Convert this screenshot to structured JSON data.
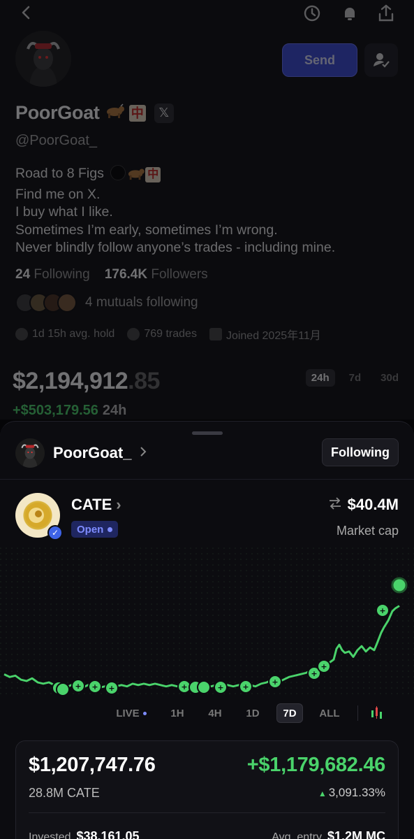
{
  "profile": {
    "display_name": "PoorGoat",
    "name_emoji": "中",
    "x_badge": "𝕏",
    "handle": "@PoorGoat_",
    "send_label": "Send",
    "bio_lines": [
      "Road to 8 Figs",
      "Find me on X.",
      "I buy what I like.",
      "Sometimes I’m early, sometimes I’m wrong.",
      "Never blindly follow anyone’s trades - including mine."
    ],
    "bio_emoji": "中",
    "following_count": "24",
    "following_label": "Following",
    "followers_count": "176.4K",
    "followers_label": "Followers",
    "mutuals_text": "4 mutuals following",
    "avg_hold": "1d 15h avg. hold",
    "trades": "769 trades",
    "joined": "Joined 2025年11月",
    "balance_main": "$2,194,912",
    "balance_cents": ".85",
    "change": "+$503,179.56",
    "change_period": "24h",
    "ranges": [
      "24h",
      "7d",
      "30d"
    ],
    "active_range": "24h"
  },
  "sheet": {
    "trader_name": "PoorGoat_",
    "following_button": "Following",
    "token_name": "CATE",
    "status": "Open",
    "market_cap": "$40.4M",
    "market_cap_label": "Market cap",
    "timeframes": [
      "LIVE",
      "1H",
      "4H",
      "1D",
      "7D",
      "ALL"
    ],
    "active_timeframe": "7D",
    "value": "$1,207,747.76",
    "pnl": "+$1,179,682.46",
    "quantity": "28.8M CATE",
    "pnl_pct": "3,091.33%",
    "invested_label": "Invested",
    "invested": "$38,161.05",
    "avg_entry_label": "Avg. entry",
    "avg_entry": "$1.2M MC"
  },
  "colors": {
    "accent_blue": "#3b4bd8",
    "positive_green": "#4ad36b",
    "open_pill": "#7e8cff"
  },
  "icons": [
    "back-icon",
    "history-icon",
    "bell-plus-icon",
    "share-icon",
    "user-check-icon",
    "verified-icon",
    "swap-icon",
    "candlestick-icon",
    "clock-icon",
    "trades-icon",
    "calendar-icon"
  ]
}
